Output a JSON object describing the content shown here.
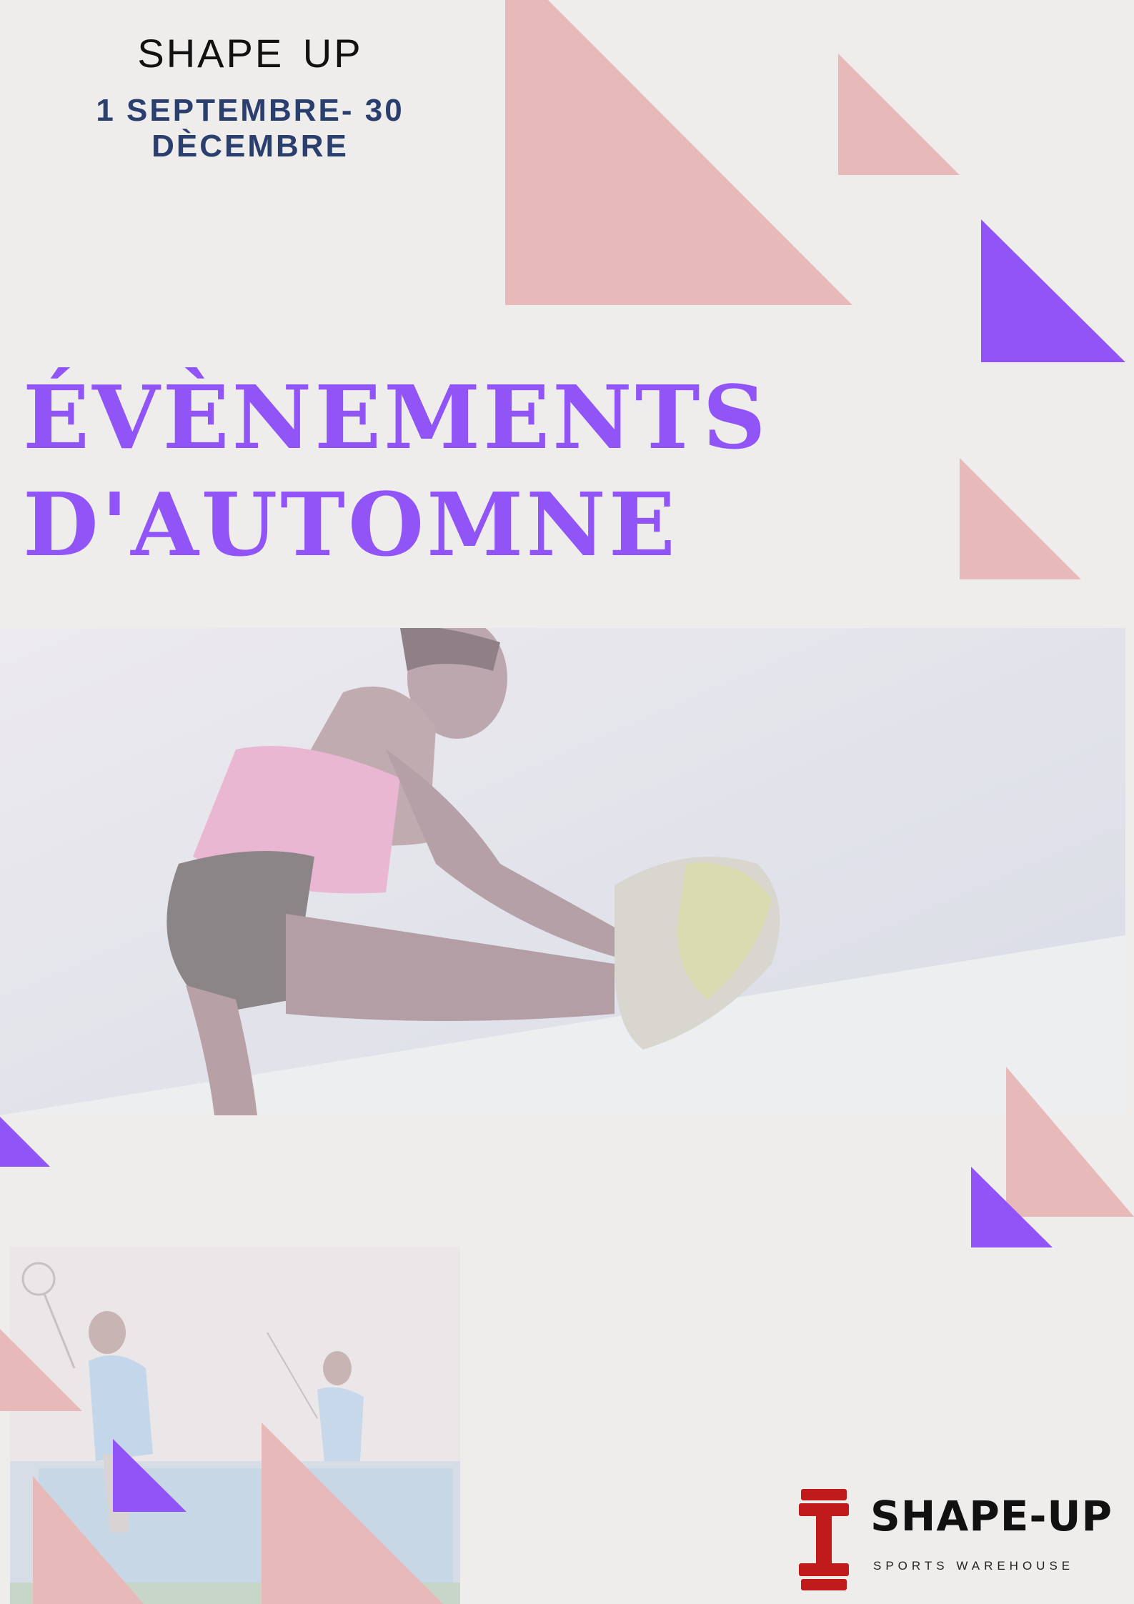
{
  "header": {
    "brand": "SHAPE UP",
    "dates": "1 SEPTEMBRE- 30 DÈCEMBRE"
  },
  "headline": {
    "line1": "ÉVÈNEMENTS",
    "line2": "D'AUTOMNE"
  },
  "logo": {
    "name": "SHAPE-UP",
    "tagline": "SPORTS WAREHOUSE",
    "icon": "dumbbell-icon"
  },
  "colors": {
    "background": "#eeedec",
    "pink": "#e8b9b9",
    "purple": "#9155f7",
    "navy": "#2b3f6e",
    "logo_red": "#c01a1a"
  }
}
